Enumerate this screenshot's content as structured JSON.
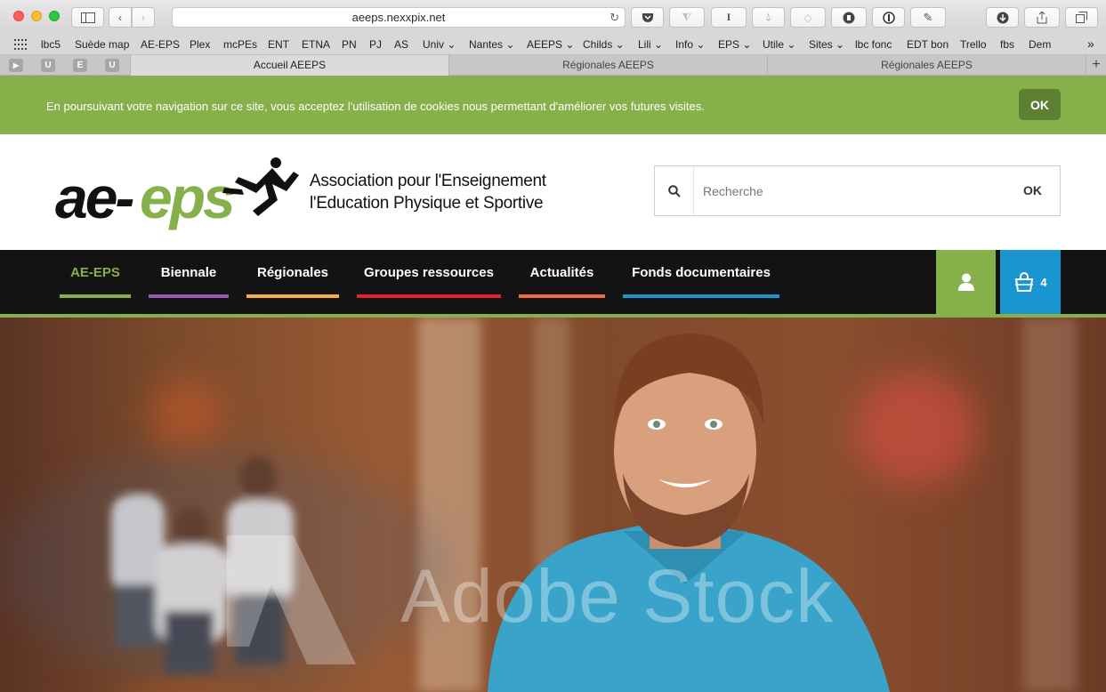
{
  "browser": {
    "url": "aeeps.nexxpix.net",
    "bookmarks": [
      {
        "label": "lbc5"
      },
      {
        "label": "Suède map"
      },
      {
        "label": "AE-EPS"
      },
      {
        "label": "Plex"
      },
      {
        "label": "mcPEs"
      },
      {
        "label": "ENT"
      },
      {
        "label": "ETNA"
      },
      {
        "label": "PN"
      },
      {
        "label": "PJ"
      },
      {
        "label": "AS"
      },
      {
        "label": "Univ ⌄"
      },
      {
        "label": "Nantes ⌄"
      },
      {
        "label": "AEEPS ⌄"
      },
      {
        "label": "Childs ⌄"
      },
      {
        "label": "Lili ⌄"
      },
      {
        "label": "Info ⌄"
      },
      {
        "label": "EPS ⌄"
      },
      {
        "label": "Utile ⌄"
      },
      {
        "label": "Sites ⌄"
      },
      {
        "label": "lbc fonc"
      },
      {
        "label": "EDT bon"
      },
      {
        "label": "Trello"
      },
      {
        "label": "fbs"
      },
      {
        "label": "Dem"
      }
    ],
    "bookmarks_overflow": "»",
    "pinned_tabs": [
      "",
      "U",
      "E",
      "U"
    ],
    "tabs": [
      {
        "label": "Accueil AEEPS",
        "active": true
      },
      {
        "label": "Régionales AEEPS",
        "active": false
      },
      {
        "label": "Régionales AEEPS",
        "active": false
      }
    ],
    "new_tab": "+"
  },
  "cookie_banner": {
    "text": "En poursuivant votre navigation sur ce site, vous acceptez l'utilisation de cookies nous permettant d'améliorer vos futures visites.",
    "ok_label": "OK"
  },
  "header": {
    "logo_text": "ae-eps",
    "tagline_line1": "Association pour l'Enseignement",
    "tagline_line2": "l'Education Physique et Sportive",
    "search_placeholder": "Recherche",
    "search_ok": "OK"
  },
  "nav": {
    "items": [
      {
        "label": "AE-EPS",
        "color": "#86b04a",
        "active": true
      },
      {
        "label": "Biennale",
        "color": "#9b59b6"
      },
      {
        "label": "Régionales",
        "color": "#f5b041"
      },
      {
        "label": "Groupes ressources",
        "color": "#e0242f"
      },
      {
        "label": "Actualités",
        "color": "#ef6c3a"
      },
      {
        "label": "Fonds documentaires",
        "color": "#1a95cf"
      }
    ],
    "cart_count": "4"
  },
  "hero": {
    "watermark": "Adobe Stock"
  },
  "colors": {
    "brand_green": "#86b04a",
    "cart_blue": "#1a95cf",
    "nav_bg": "#131313"
  }
}
